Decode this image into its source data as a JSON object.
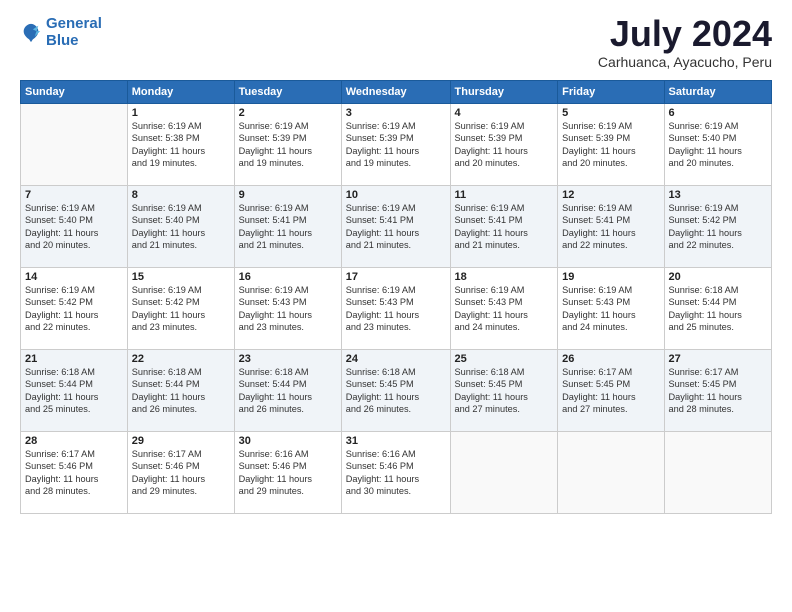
{
  "header": {
    "logo_line1": "General",
    "logo_line2": "Blue",
    "month_title": "July 2024",
    "subtitle": "Carhuanca, Ayacucho, Peru"
  },
  "weekdays": [
    "Sunday",
    "Monday",
    "Tuesday",
    "Wednesday",
    "Thursday",
    "Friday",
    "Saturday"
  ],
  "weeks": [
    [
      {
        "day": "",
        "info": ""
      },
      {
        "day": "1",
        "info": "Sunrise: 6:19 AM\nSunset: 5:38 PM\nDaylight: 11 hours\nand 19 minutes."
      },
      {
        "day": "2",
        "info": "Sunrise: 6:19 AM\nSunset: 5:39 PM\nDaylight: 11 hours\nand 19 minutes."
      },
      {
        "day": "3",
        "info": "Sunrise: 6:19 AM\nSunset: 5:39 PM\nDaylight: 11 hours\nand 19 minutes."
      },
      {
        "day": "4",
        "info": "Sunrise: 6:19 AM\nSunset: 5:39 PM\nDaylight: 11 hours\nand 20 minutes."
      },
      {
        "day": "5",
        "info": "Sunrise: 6:19 AM\nSunset: 5:39 PM\nDaylight: 11 hours\nand 20 minutes."
      },
      {
        "day": "6",
        "info": "Sunrise: 6:19 AM\nSunset: 5:40 PM\nDaylight: 11 hours\nand 20 minutes."
      }
    ],
    [
      {
        "day": "7",
        "info": "Sunrise: 6:19 AM\nSunset: 5:40 PM\nDaylight: 11 hours\nand 20 minutes."
      },
      {
        "day": "8",
        "info": "Sunrise: 6:19 AM\nSunset: 5:40 PM\nDaylight: 11 hours\nand 21 minutes."
      },
      {
        "day": "9",
        "info": "Sunrise: 6:19 AM\nSunset: 5:41 PM\nDaylight: 11 hours\nand 21 minutes."
      },
      {
        "day": "10",
        "info": "Sunrise: 6:19 AM\nSunset: 5:41 PM\nDaylight: 11 hours\nand 21 minutes."
      },
      {
        "day": "11",
        "info": "Sunrise: 6:19 AM\nSunset: 5:41 PM\nDaylight: 11 hours\nand 21 minutes."
      },
      {
        "day": "12",
        "info": "Sunrise: 6:19 AM\nSunset: 5:41 PM\nDaylight: 11 hours\nand 22 minutes."
      },
      {
        "day": "13",
        "info": "Sunrise: 6:19 AM\nSunset: 5:42 PM\nDaylight: 11 hours\nand 22 minutes."
      }
    ],
    [
      {
        "day": "14",
        "info": "Sunrise: 6:19 AM\nSunset: 5:42 PM\nDaylight: 11 hours\nand 22 minutes."
      },
      {
        "day": "15",
        "info": "Sunrise: 6:19 AM\nSunset: 5:42 PM\nDaylight: 11 hours\nand 23 minutes."
      },
      {
        "day": "16",
        "info": "Sunrise: 6:19 AM\nSunset: 5:43 PM\nDaylight: 11 hours\nand 23 minutes."
      },
      {
        "day": "17",
        "info": "Sunrise: 6:19 AM\nSunset: 5:43 PM\nDaylight: 11 hours\nand 23 minutes."
      },
      {
        "day": "18",
        "info": "Sunrise: 6:19 AM\nSunset: 5:43 PM\nDaylight: 11 hours\nand 24 minutes."
      },
      {
        "day": "19",
        "info": "Sunrise: 6:19 AM\nSunset: 5:43 PM\nDaylight: 11 hours\nand 24 minutes."
      },
      {
        "day": "20",
        "info": "Sunrise: 6:18 AM\nSunset: 5:44 PM\nDaylight: 11 hours\nand 25 minutes."
      }
    ],
    [
      {
        "day": "21",
        "info": "Sunrise: 6:18 AM\nSunset: 5:44 PM\nDaylight: 11 hours\nand 25 minutes."
      },
      {
        "day": "22",
        "info": "Sunrise: 6:18 AM\nSunset: 5:44 PM\nDaylight: 11 hours\nand 26 minutes."
      },
      {
        "day": "23",
        "info": "Sunrise: 6:18 AM\nSunset: 5:44 PM\nDaylight: 11 hours\nand 26 minutes."
      },
      {
        "day": "24",
        "info": "Sunrise: 6:18 AM\nSunset: 5:45 PM\nDaylight: 11 hours\nand 26 minutes."
      },
      {
        "day": "25",
        "info": "Sunrise: 6:18 AM\nSunset: 5:45 PM\nDaylight: 11 hours\nand 27 minutes."
      },
      {
        "day": "26",
        "info": "Sunrise: 6:17 AM\nSunset: 5:45 PM\nDaylight: 11 hours\nand 27 minutes."
      },
      {
        "day": "27",
        "info": "Sunrise: 6:17 AM\nSunset: 5:45 PM\nDaylight: 11 hours\nand 28 minutes."
      }
    ],
    [
      {
        "day": "28",
        "info": "Sunrise: 6:17 AM\nSunset: 5:46 PM\nDaylight: 11 hours\nand 28 minutes."
      },
      {
        "day": "29",
        "info": "Sunrise: 6:17 AM\nSunset: 5:46 PM\nDaylight: 11 hours\nand 29 minutes."
      },
      {
        "day": "30",
        "info": "Sunrise: 6:16 AM\nSunset: 5:46 PM\nDaylight: 11 hours\nand 29 minutes."
      },
      {
        "day": "31",
        "info": "Sunrise: 6:16 AM\nSunset: 5:46 PM\nDaylight: 11 hours\nand 30 minutes."
      },
      {
        "day": "",
        "info": ""
      },
      {
        "day": "",
        "info": ""
      },
      {
        "day": "",
        "info": ""
      }
    ]
  ]
}
